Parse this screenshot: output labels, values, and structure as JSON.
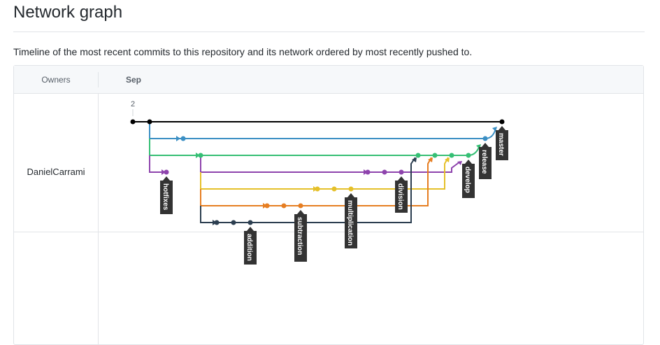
{
  "page": {
    "title": "Network graph",
    "description": "Timeline of the most recent commits to this repository and its network ordered by most recently pushed to."
  },
  "header": {
    "owners": "Owners",
    "month": "Sep"
  },
  "owners": [
    {
      "name": "DanielCarrami"
    }
  ],
  "graph": {
    "day": "2",
    "branches": [
      {
        "name": "master",
        "color": "#000000"
      },
      {
        "name": "release",
        "color": "#3b8fc4"
      },
      {
        "name": "develop",
        "color": "#35bf74"
      },
      {
        "name": "hotfixes",
        "color": "#8e44ad"
      },
      {
        "name": "division",
        "color": "#8e44ad"
      },
      {
        "name": "multiplication",
        "color": "#e5c02a"
      },
      {
        "name": "subtraction",
        "color": "#e67e22"
      },
      {
        "name": "addition",
        "color": "#2c3e50"
      }
    ]
  }
}
